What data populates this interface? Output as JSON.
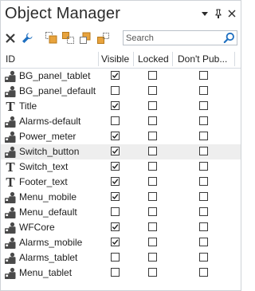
{
  "panel": {
    "title": "Object Manager",
    "controls": {
      "dropdown": "▾",
      "pin": "⊥",
      "close": "✕"
    }
  },
  "toolbar": {
    "search_placeholder": "Search"
  },
  "columns": {
    "id": "ID",
    "visible": "Visible",
    "locked": "Locked",
    "dont_publish": "Don't Pub..."
  },
  "rows": [
    {
      "name": "BG_panel_tablet",
      "icon": "object-icon",
      "visible": true,
      "locked": false,
      "dont_publish": false
    },
    {
      "name": "BG_panel_default",
      "icon": "object-icon",
      "visible": false,
      "locked": false,
      "dont_publish": false
    },
    {
      "name": "Title",
      "icon": "text-icon",
      "visible": true,
      "locked": false,
      "dont_publish": false
    },
    {
      "name": "Alarms-default",
      "icon": "object-icon",
      "visible": false,
      "locked": false,
      "dont_publish": false
    },
    {
      "name": "Power_meter",
      "icon": "object-icon",
      "visible": true,
      "locked": false,
      "dont_publish": false
    },
    {
      "name": "Switch_button",
      "icon": "object-icon",
      "visible": true,
      "locked": false,
      "dont_publish": false,
      "highlighted": true
    },
    {
      "name": "Switch_text",
      "icon": "text-icon",
      "visible": true,
      "locked": false,
      "dont_publish": false
    },
    {
      "name": "Footer_text",
      "icon": "text-icon",
      "visible": true,
      "locked": false,
      "dont_publish": false
    },
    {
      "name": "Menu_mobile",
      "icon": "object-icon",
      "visible": true,
      "locked": false,
      "dont_publish": false
    },
    {
      "name": "Menu_default",
      "icon": "object-icon",
      "visible": false,
      "locked": false,
      "dont_publish": false
    },
    {
      "name": "WFCore",
      "icon": "object-icon",
      "visible": true,
      "locked": false,
      "dont_publish": false
    },
    {
      "name": "Alarms_mobile",
      "icon": "object-icon",
      "visible": true,
      "locked": false,
      "dont_publish": false
    },
    {
      "name": "Alarms_tablet",
      "icon": "object-icon",
      "visible": false,
      "locked": false,
      "dont_publish": false
    },
    {
      "name": "Menu_tablet",
      "icon": "object-icon",
      "visible": false,
      "locked": false,
      "dont_publish": false
    }
  ],
  "colors": {
    "accent_blue": "#1e6fc0",
    "orange": "#e8a33d",
    "highlight_row": "#eeeeee"
  }
}
